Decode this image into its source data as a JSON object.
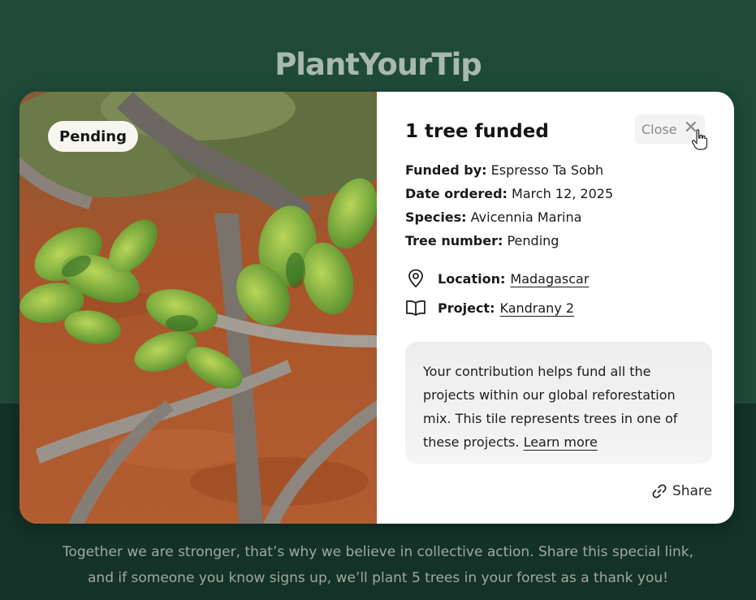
{
  "brand": {
    "name": "PlantYourTip"
  },
  "card": {
    "status_pill": "Pending",
    "title": "1 tree funded",
    "close_label": "Close",
    "details": {
      "funded_by_label": "Funded by:",
      "funded_by_value": "Espresso Ta Sobh",
      "date_ordered_label": "Date ordered:",
      "date_ordered_value": "March 12, 2025",
      "species_label": "Species:",
      "species_value": "Avicennia Marina",
      "tree_number_label": "Tree number:",
      "tree_number_value": "Pending"
    },
    "location": {
      "label": "Location:",
      "value": "Madagascar",
      "icon": "location-pin-icon"
    },
    "project": {
      "label": "Project:",
      "value": "Kandrany 2",
      "icon": "book-icon"
    },
    "note": {
      "line1": "Your contribution helps fund all the",
      "line2": "projects within our global reforestation",
      "line3": "mix. This tile represents trees in one of",
      "line4_prefix": "these projects.",
      "learn_more": "Learn more"
    },
    "share_label": "Share"
  },
  "footer": {
    "line1": "Together we are stronger, that’s why we believe in collective action. Share this special link,",
    "line2": "and if someone you know signs up, we’ll plant 5 trees in your forest as a thank you!"
  },
  "colors": {
    "background_top": "#1f4a39",
    "background_bottom": "#143227",
    "brand_text": "#a8b9ae",
    "footer_text": "#9eaaa1"
  }
}
